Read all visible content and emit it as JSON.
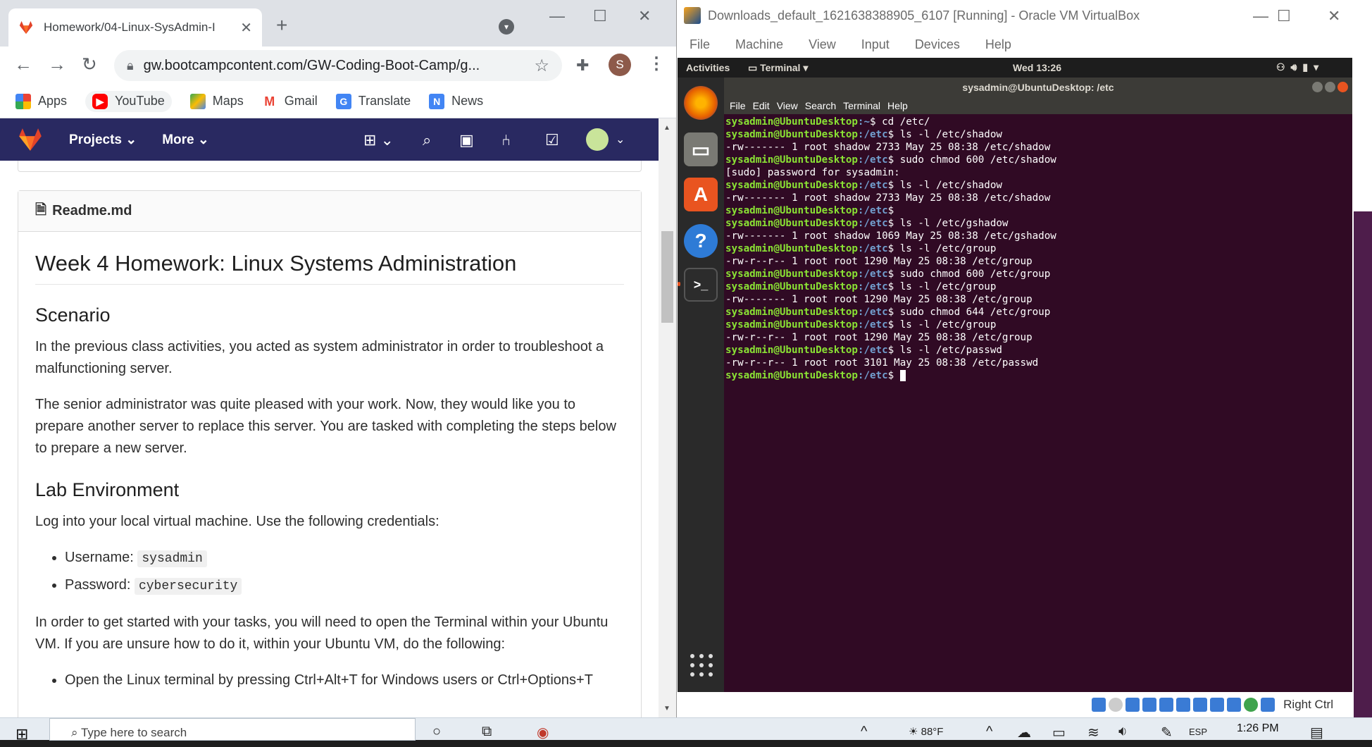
{
  "chrome": {
    "tab_title": "Homework/04-Linux-SysAdmin-I",
    "url": "gw.bootcampcontent.com/GW-Coding-Boot-Camp/g...",
    "profile_initial": "S",
    "bookmarks": [
      {
        "label": "Apps",
        "icon": "apps-grid-icon"
      },
      {
        "label": "YouTube",
        "icon": "youtube-icon"
      },
      {
        "label": "Maps",
        "icon": "maps-icon"
      },
      {
        "label": "Gmail",
        "icon": "gmail-icon"
      },
      {
        "label": "Translate",
        "icon": "translate-icon"
      },
      {
        "label": "News",
        "icon": "news-icon"
      }
    ]
  },
  "gitlab": {
    "nav": {
      "projects": "Projects",
      "more": "More"
    },
    "readme": {
      "filename": "Readme.md",
      "h1": "Week 4 Homework: Linux Systems Administration",
      "scenario_heading": "Scenario",
      "p1": "In the previous class activities, you acted as system administrator in order to troubleshoot a malfunctioning server.",
      "p2": "The senior administrator was quite pleased with your work. Now, they would like you to prepare another server to replace this server. You are tasked with completing the steps below to prepare a new server.",
      "lab_heading": "Lab Environment",
      "p3": "Log into your local virtual machine. Use the following credentials:",
      "username_label": "Username:",
      "username_value": "sysadmin",
      "password_label": "Password:",
      "password_value": "cybersecurity",
      "p4": "In order to get started with your tasks, you will need to open the Terminal within your Ubuntu VM. If you are unsure how to do it, within your Ubuntu VM, do the following:",
      "li_partial": "Open the Linux terminal by pressing Ctrl+Alt+T for Windows users or Ctrl+Options+T"
    }
  },
  "vbox": {
    "title": "Downloads_default_1621638388905_6107 [Running] - Oracle VM VirtualBox",
    "menu": [
      "File",
      "Machine",
      "View",
      "Input",
      "Devices",
      "Help"
    ],
    "host_key": "Right Ctrl"
  },
  "ubuntu": {
    "activities": "Activities",
    "app_menu": "Terminal ▾",
    "clock": "Wed 13:26",
    "terminal_title": "sysadmin@UbuntuDesktop: /etc",
    "terminal_menu": [
      "File",
      "Edit",
      "View",
      "Search",
      "Terminal",
      "Help"
    ],
    "terminal_lines": [
      {
        "type": "prompt",
        "user": "sysadmin@UbuntuDesktop",
        "path": ":~",
        "cmd": "$ cd /etc/"
      },
      {
        "type": "prompt",
        "user": "sysadmin@UbuntuDesktop",
        "path": ":/etc",
        "cmd": "$ ls -l /etc/shadow"
      },
      {
        "type": "out",
        "text": "-rw------- 1 root shadow 2733 May 25 08:38 /etc/shadow"
      },
      {
        "type": "prompt",
        "user": "sysadmin@UbuntuDesktop",
        "path": ":/etc",
        "cmd": "$ sudo chmod 600 /etc/shadow"
      },
      {
        "type": "out",
        "text": "[sudo] password for sysadmin:"
      },
      {
        "type": "prompt",
        "user": "sysadmin@UbuntuDesktop",
        "path": ":/etc",
        "cmd": "$ ls -l /etc/shadow"
      },
      {
        "type": "out",
        "text": "-rw------- 1 root shadow 2733 May 25 08:38 /etc/shadow"
      },
      {
        "type": "prompt",
        "user": "sysadmin@UbuntuDesktop",
        "path": ":/etc",
        "cmd": "$"
      },
      {
        "type": "prompt",
        "user": "sysadmin@UbuntuDesktop",
        "path": ":/etc",
        "cmd": "$ ls -l /etc/gshadow"
      },
      {
        "type": "out",
        "text": "-rw------- 1 root shadow 1069 May 25 08:38 /etc/gshadow"
      },
      {
        "type": "prompt",
        "user": "sysadmin@UbuntuDesktop",
        "path": ":/etc",
        "cmd": "$ ls -l /etc/group"
      },
      {
        "type": "out",
        "text": "-rw-r--r-- 1 root root 1290 May 25 08:38 /etc/group"
      },
      {
        "type": "prompt",
        "user": "sysadmin@UbuntuDesktop",
        "path": ":/etc",
        "cmd": "$ sudo chmod 600 /etc/group"
      },
      {
        "type": "prompt",
        "user": "sysadmin@UbuntuDesktop",
        "path": ":/etc",
        "cmd": "$ ls -l /etc/group"
      },
      {
        "type": "out",
        "text": "-rw------- 1 root root 1290 May 25 08:38 /etc/group"
      },
      {
        "type": "prompt",
        "user": "sysadmin@UbuntuDesktop",
        "path": ":/etc",
        "cmd": "$ sudo chmod 644 /etc/group"
      },
      {
        "type": "prompt",
        "user": "sysadmin@UbuntuDesktop",
        "path": ":/etc",
        "cmd": "$ ls -l /etc/group"
      },
      {
        "type": "out",
        "text": "-rw-r--r-- 1 root root 1290 May 25 08:38 /etc/group"
      },
      {
        "type": "prompt",
        "user": "sysadmin@UbuntuDesktop",
        "path": ":/etc",
        "cmd": "$ ls -l /etc/passwd"
      },
      {
        "type": "out",
        "text": "-rw-r--r-- 1 root root 3101 May 25 08:38 /etc/passwd"
      },
      {
        "type": "prompt",
        "user": "sysadmin@UbuntuDesktop",
        "path": ":/etc",
        "cmd": "$ ",
        "cursor": true
      }
    ],
    "colors": {
      "prompt_user": "#8ae234",
      "prompt_path": "#729fcf",
      "terminal_bg": "#300a24"
    }
  },
  "taskbar": {
    "search_placeholder": "Type here to search",
    "weather": "88°F",
    "lang": "ESP",
    "time": "1:26 PM"
  }
}
